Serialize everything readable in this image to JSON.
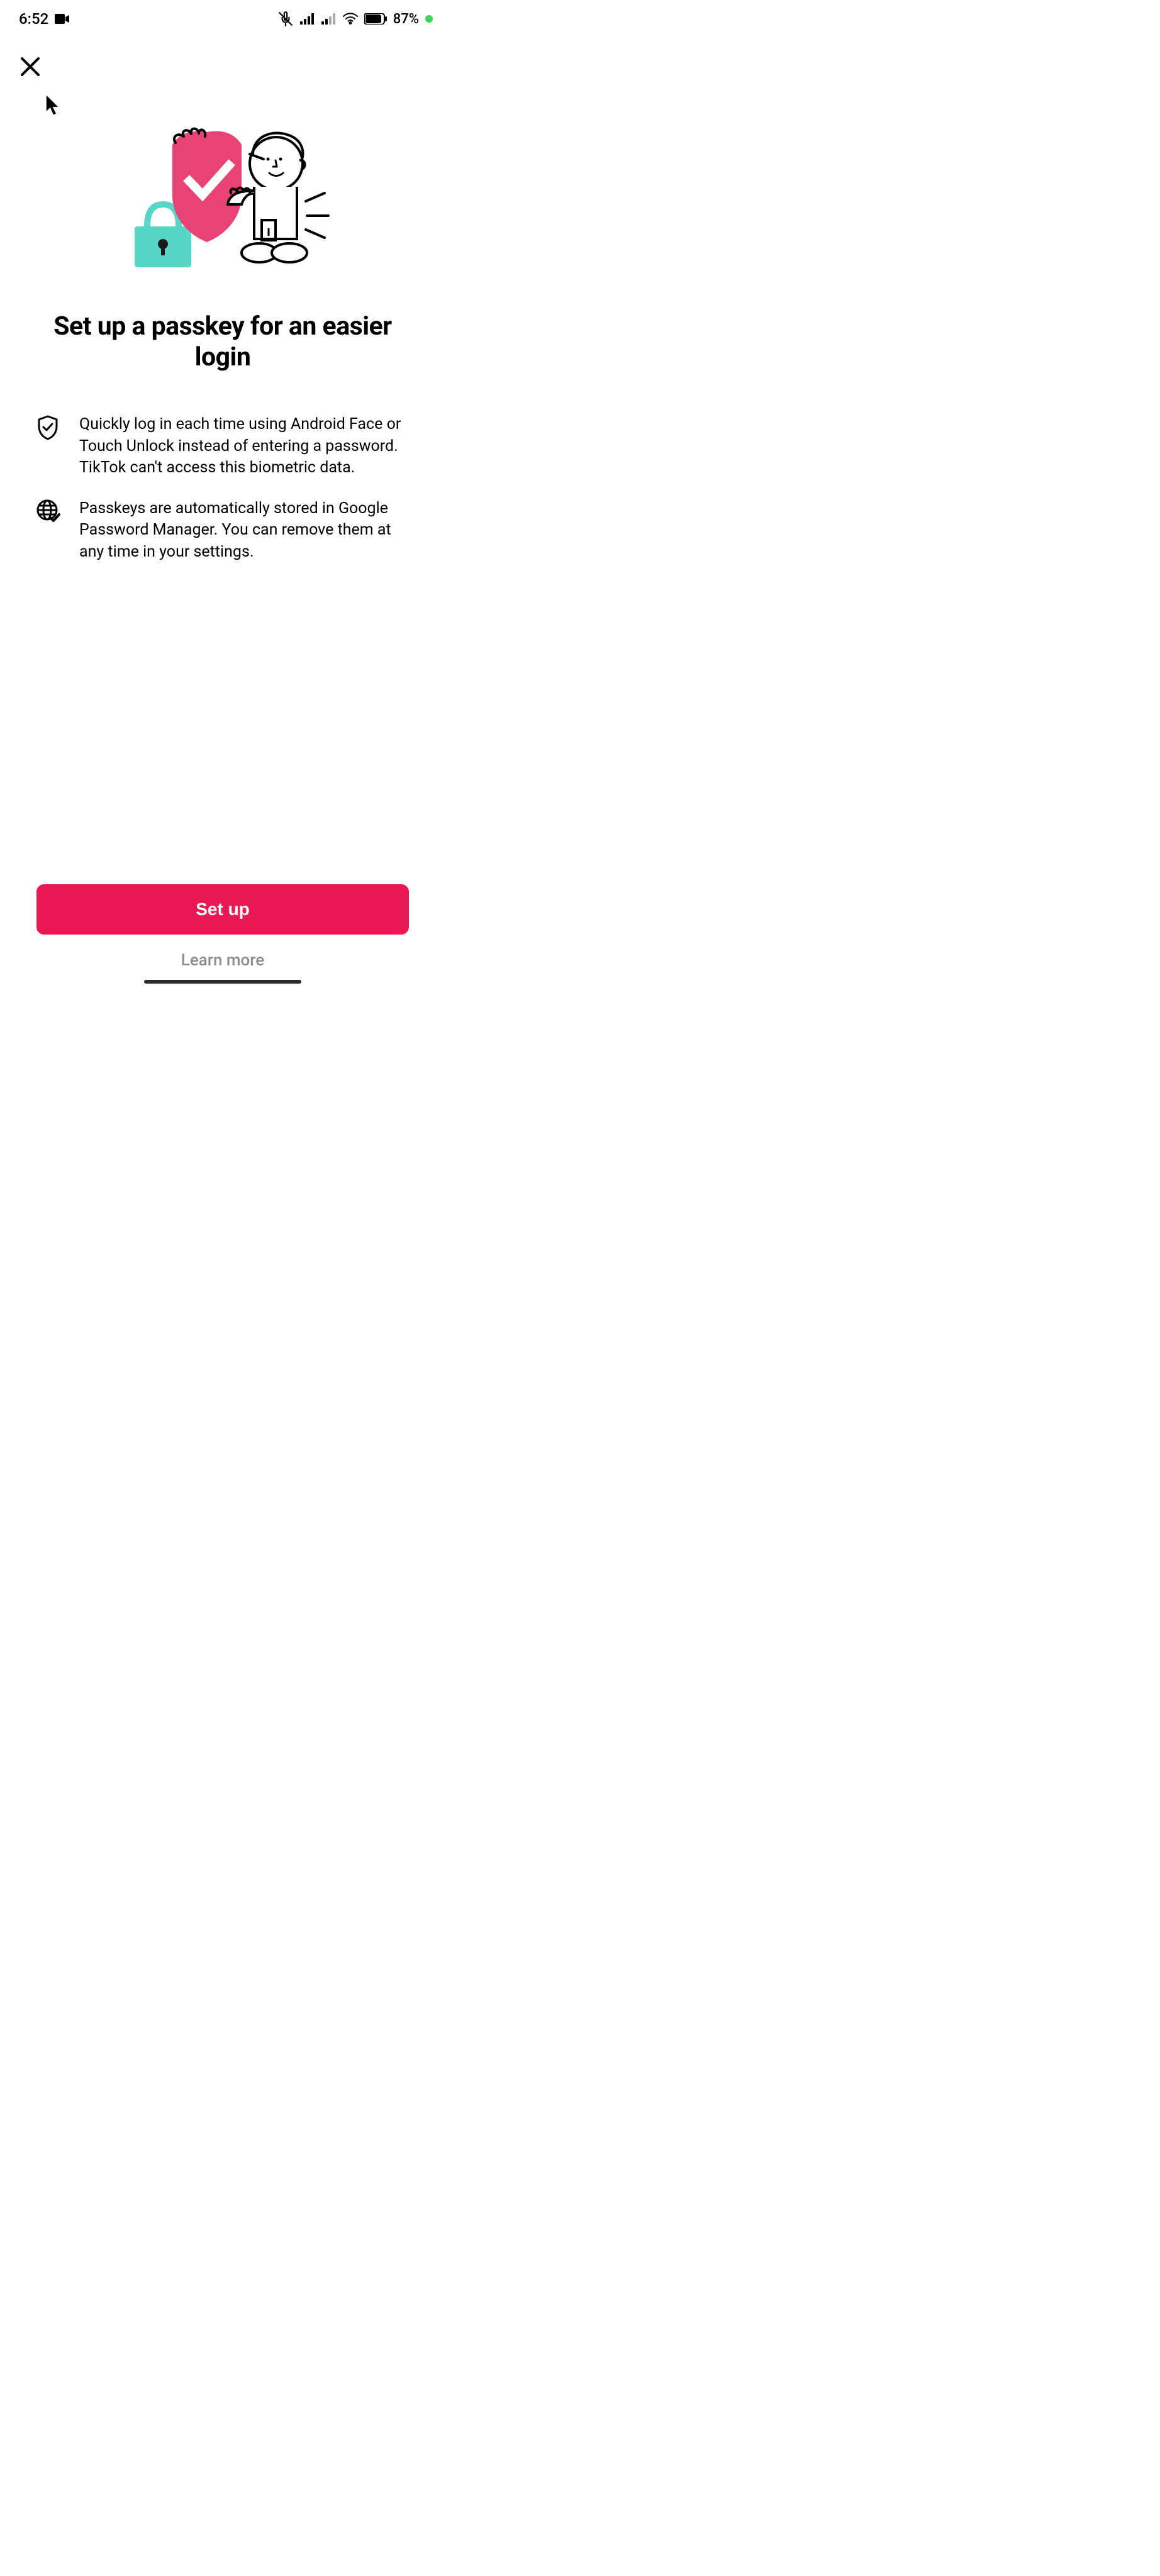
{
  "status": {
    "time": "6:52",
    "battery": "87%"
  },
  "main": {
    "title": "Set up a passkey for an easier login",
    "features": [
      "Quickly log in each time using Android Face or Touch Unlock instead of entering a password. TikTok can't access this biometric data.",
      "Passkeys are automatically stored in Google Password Manager. You can remove them at any time in your settings."
    ]
  },
  "actions": {
    "setup": "Set up",
    "learn_more": "Learn more"
  }
}
